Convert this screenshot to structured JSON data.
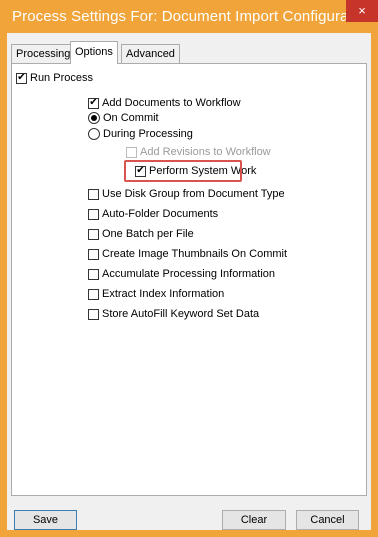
{
  "window": {
    "title": "Process Settings For: Document Import Configuration",
    "close_glyph": "×"
  },
  "tabs": [
    {
      "label": "Processing",
      "active": false
    },
    {
      "label": "Options",
      "active": true
    },
    {
      "label": "Advanced",
      "active": false
    }
  ],
  "options": {
    "run_process": {
      "label": "Run Process",
      "checked": true
    },
    "add_documents": {
      "label": "Add Documents to Workflow",
      "checked": true
    },
    "on_commit": {
      "label": "On Commit",
      "selected": true
    },
    "during_processing": {
      "label": "During Processing",
      "selected": false
    },
    "add_revisions": {
      "label": "Add Revisions to Workflow",
      "checked": false,
      "enabled": false
    },
    "perform_system_work": {
      "label": "Perform System Work",
      "checked": true
    },
    "use_disk_group": {
      "label": "Use Disk Group from Document Type",
      "checked": false
    },
    "auto_folder": {
      "label": "Auto-Folder Documents",
      "checked": false
    },
    "one_batch": {
      "label": "One Batch per File",
      "checked": false
    },
    "create_thumbnails": {
      "label": "Create Image Thumbnails On Commit",
      "checked": false
    },
    "accumulate_info": {
      "label": "Accumulate Processing Information",
      "checked": false
    },
    "extract_index": {
      "label": "Extract Index Information",
      "checked": false
    },
    "store_autofill": {
      "label": "Store AutoFill Keyword Set Data",
      "checked": false
    }
  },
  "checkmark_glyph": "✔",
  "buttons": {
    "save": "Save",
    "clear": "Clear",
    "cancel": "Cancel"
  },
  "colors": {
    "frame": "#f0a43a",
    "close": "#c7342a",
    "highlight": "#d9534f"
  }
}
